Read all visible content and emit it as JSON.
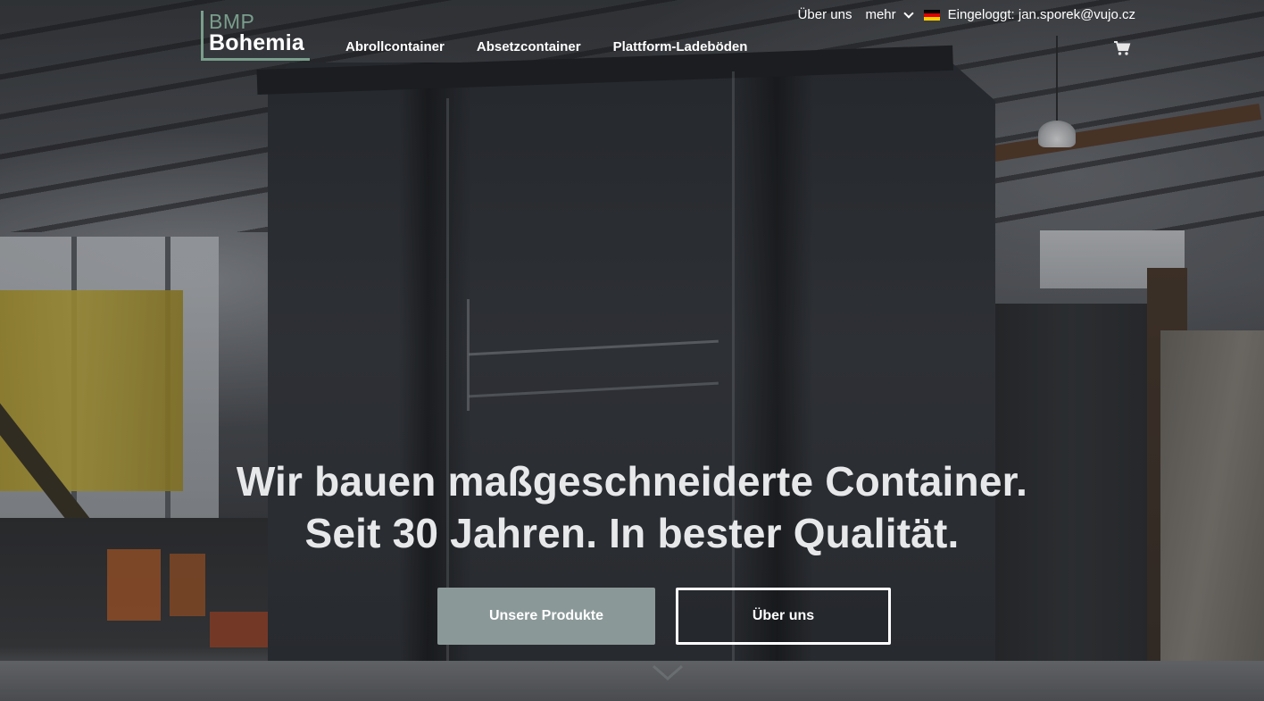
{
  "header": {
    "logo": {
      "line1": "BMP",
      "line2": "Bohemia"
    },
    "nav": [
      {
        "label": "Abrollcontainer"
      },
      {
        "label": "Absetzcontainer"
      },
      {
        "label": "Plattform-Ladeböden"
      }
    ],
    "top_bar": {
      "about_label": "Über uns",
      "more_label": "mehr",
      "language_flag": "de-flag-icon",
      "login_status": "Eingeloggt: jan.sporek@vujo.cz"
    },
    "cart_icon": "shopping-cart-icon"
  },
  "hero": {
    "headline_line1": "Wir bauen maßgeschneiderte Container.",
    "headline_line2": "Seit 30 Jahren. In bester Qualität.",
    "primary_button": "Unsere Produkte",
    "secondary_button": "Über uns",
    "scroll_icon": "chevron-down-icon"
  },
  "colors": {
    "brand_green": "#7a9e8c",
    "primary_button_bg": "#8b9898",
    "text": "#ffffff"
  }
}
